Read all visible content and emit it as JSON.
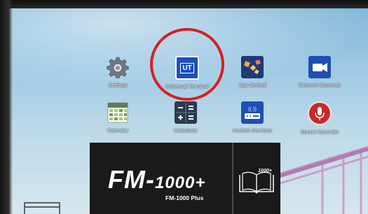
{
  "apps": [
    {
      "id": "settings",
      "label": "Settings",
      "icon": "gear-icon"
    },
    {
      "id": "universal-terminal",
      "label": "Universal Terminal",
      "icon": "ut-icon",
      "icon_text": "UT"
    },
    {
      "id": "app-central",
      "label": "App Central",
      "icon": "app-central-icon"
    },
    {
      "id": "external-cameras",
      "label": "External Cameras",
      "icon": "video-camera-icon"
    },
    {
      "id": "calendar",
      "label": "Calendar",
      "icon": "calendar-icon"
    },
    {
      "id": "calculator",
      "label": "Calculator",
      "icon": "calculator-icon"
    },
    {
      "id": "modem-services",
      "label": "Modem Services",
      "icon": "modem-icon",
      "icon_text": "((·))"
    },
    {
      "id": "sound-recorder",
      "label": "Sound Recorder",
      "icon": "microphone-icon"
    }
  ],
  "banner": {
    "brand_prefix": "FM-",
    "brand_model": "1000+",
    "subtitle": "FM-1000 Plus",
    "manual_badge": "1000+"
  },
  "colors": {
    "highlight": "#d62020",
    "ut_icon_bg": "#1d4fb8",
    "app_central_bg": "#1f3a7a",
    "camera_bg": "#1f4fb0",
    "mic_bg": "#c82a2a"
  }
}
